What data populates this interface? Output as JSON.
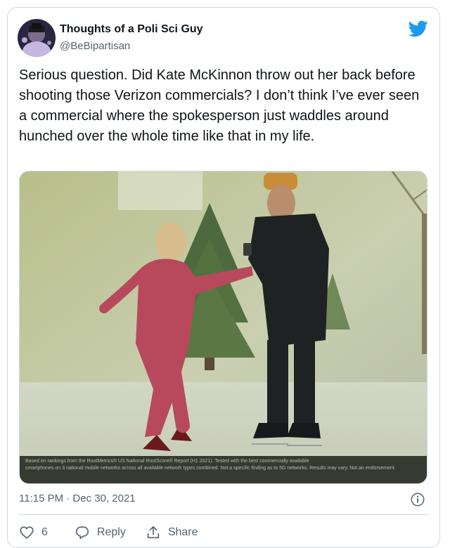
{
  "tweet": {
    "author_name": "Thoughts of a Poli Sci Guy",
    "author_handle": "@BeBipartisan",
    "text": "Serious question. Did Kate McKinnon throw out her back before shooting those Verizon commercials? I don’t think I’ve ever seen a commercial where the spokesperson just waddles around hunched over the whole time like that in my life.",
    "media_caption_line1": "Based on rankings from the RootMetrics® US National RootScore® Report (H1 2021). Tested with the best commercially available",
    "media_caption_line2": "smartphones on 3 national mobile networks across all available network types combined. Not a specific finding as to 5G networks. Results may vary. Not an endorsement.",
    "timestamp": "11:15 PM · Dec 30, 2021"
  },
  "actions": {
    "like_count": "6",
    "reply_label": "Reply",
    "share_label": "Share"
  },
  "icons": {
    "brand": "twitter-bird-icon",
    "info": "info-icon",
    "like": "heart-icon",
    "reply": "reply-bubble-icon",
    "share": "share-icon"
  },
  "colors": {
    "twitter_blue": "#1d9bf0",
    "secondary_text": "#536471",
    "border": "#cfd9de"
  }
}
